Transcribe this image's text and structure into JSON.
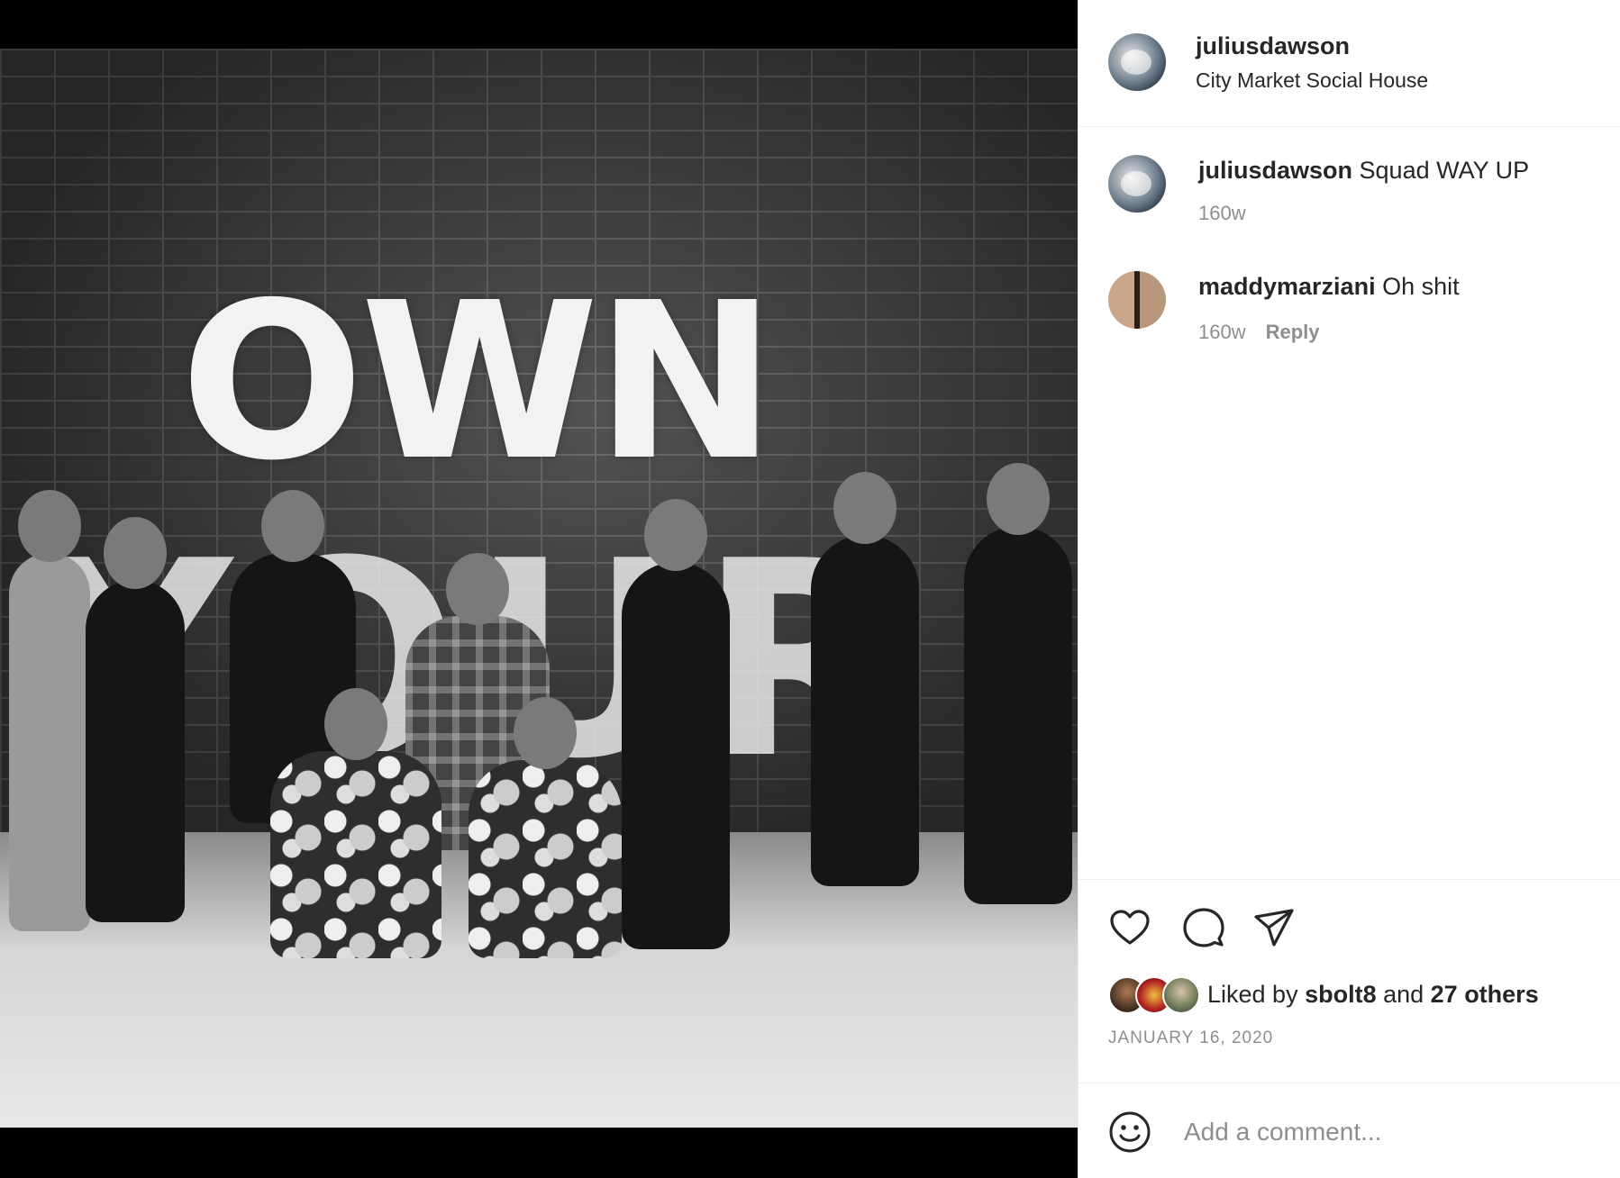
{
  "post": {
    "author": "juliusdawson",
    "location": "City Market Social House",
    "photo_text_line1": "OWN",
    "photo_text_line2": "YOUR"
  },
  "comments": [
    {
      "username": "juliusdawson",
      "text": " Squad WAY UP",
      "age": "160w"
    },
    {
      "username": "maddymarziani",
      "text": " Oh shit",
      "age": "160w",
      "reply_label": "Reply"
    }
  ],
  "actions": {
    "like_icon": "heart-icon",
    "comment_icon": "speech-bubble-icon",
    "share_icon": "paper-plane-icon"
  },
  "likes": {
    "prefix": "Liked by ",
    "first_user": "sbolt8",
    "middle": " and ",
    "others": "27 others"
  },
  "date": "JANUARY 16, 2020",
  "comment_box": {
    "placeholder": "Add a comment...",
    "emoji_icon": "smiley-icon"
  },
  "colors": {
    "text": "#262626",
    "secondary": "#8e8e8e",
    "divider": "#efefef"
  }
}
